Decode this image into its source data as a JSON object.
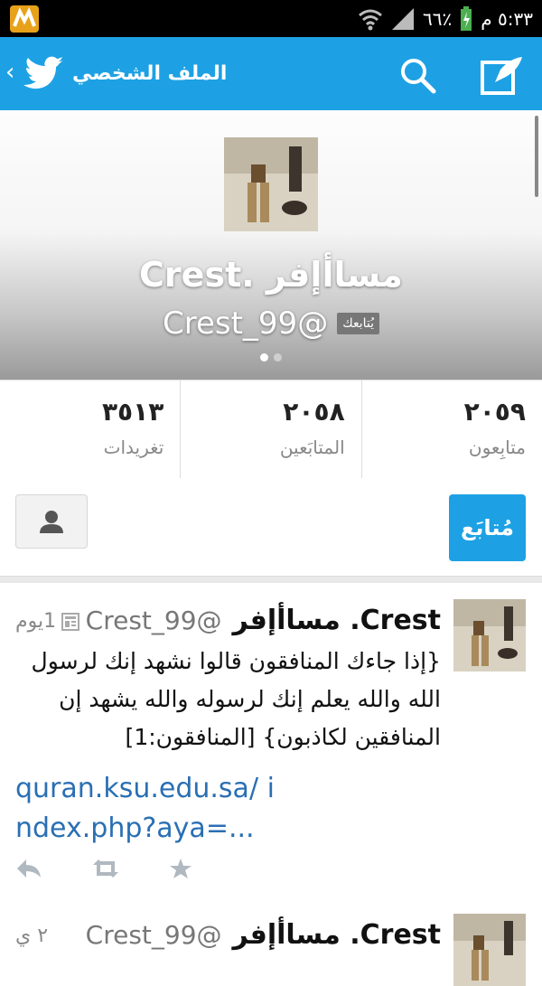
{
  "status_bar": {
    "time": "٥:٣٣ م",
    "battery": "٦٦٪"
  },
  "app_bar": {
    "title": "الملف الشخصي"
  },
  "profile": {
    "name": "Crest. مساأإفر",
    "handle": "@Crest_99",
    "follows_you": "يُتابعك"
  },
  "stats": [
    {
      "count": "٢٠٥٩",
      "label": "متابِعون"
    },
    {
      "count": "٢٠٥٨",
      "label": "المتابَعين"
    },
    {
      "count": "٣٥١٣",
      "label": "تغريدات"
    }
  ],
  "actions": {
    "follow_label": "مُتابَع"
  },
  "tweets": [
    {
      "name": "Crest. مساأإفر",
      "handle": "@Crest_99",
      "time": "1يوم",
      "text": "{إذا جاءك المنافقون قالوا نشهد إنك لرسول الله والله يعلم إنك لرسوله والله يشهد إن المنافقين لكاذبون} [المنافقون:1]",
      "link": "quran.ksu.edu.sa/ index.php?aya=..."
    },
    {
      "name": "Crest. مساأإفر",
      "handle": "@Crest_99",
      "time": "٢ ي"
    }
  ],
  "colors": {
    "brand": "#1da1e4",
    "link": "#2a6fb3"
  },
  "icons": [
    "twitter-bird-icon",
    "search-icon",
    "compose-icon",
    "person-icon",
    "reply-icon",
    "retweet-icon",
    "favorite-icon",
    "news-icon"
  ]
}
